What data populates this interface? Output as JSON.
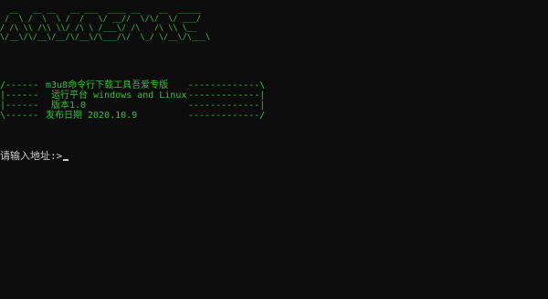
{
  "console": {
    "banner_art": [
      "  __   __ __   __ ___  ____ __    __  _____  ",
      " /  \\ /  \\  \\ /  /   \\/ __//  \\/\\/  \\/ ___/  ",
      "/ /\\ \\\\ /\\\\ \\\\/ /\\ \\ /___\\/ /\\   /\\ \\\\ \\__   ",
      "\\/__\\/\\/__\\/__/\\/__\\/\\___/\\/  \\_/ \\/__\\/\\___\\ "
    ],
    "info_lines": [
      {
        "lead": "/------",
        "text": "m3u8命令行下载工具吾爱专版",
        "trail": "-------------\\"
      },
      {
        "lead": "|------",
        "text": " 运行平台 windows and Linux",
        "trail": "-------------|"
      },
      {
        "lead": "|------",
        "text": " 版本1.0",
        "trail": "-------------|"
      },
      {
        "lead": "\\------",
        "text": "发布日期 2020.10.9",
        "trail": "-------------/"
      }
    ],
    "prompt": "请输入地址:>"
  }
}
